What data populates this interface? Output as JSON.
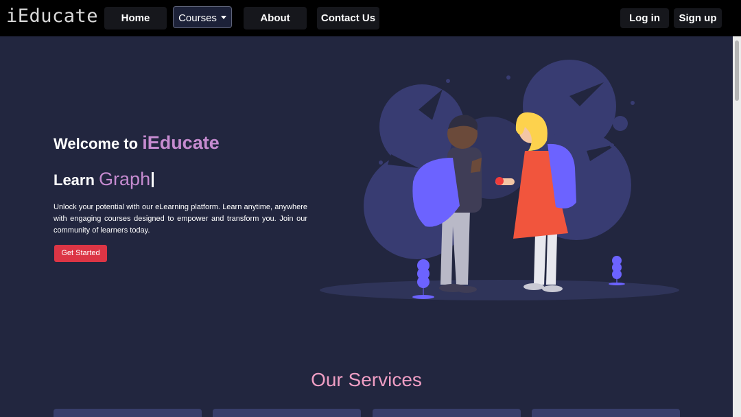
{
  "navbar": {
    "brand": "iEducate",
    "links": [
      "Home",
      "Courses",
      "About",
      "Contact Us"
    ],
    "login_label": "Log in",
    "signup_label": "Sign up"
  },
  "hero": {
    "welcome_prefix": "Welcome to",
    "welcome_brand": "iEducate",
    "learn_prefix": "Learn",
    "learn_word": "Graph",
    "description": "Unlock your potential with our eLearning platform. Learn anytime, anywhere with engaging courses designed to empower and transform you. Join our community of learners today.",
    "cta_label": "Get Started"
  },
  "services": {
    "title": "Our Services"
  },
  "colors": {
    "page_bg": "#22263f",
    "accent_purple": "#c68bd0",
    "accent_pink": "#ef9ec4",
    "cta_red": "#dc3545"
  }
}
